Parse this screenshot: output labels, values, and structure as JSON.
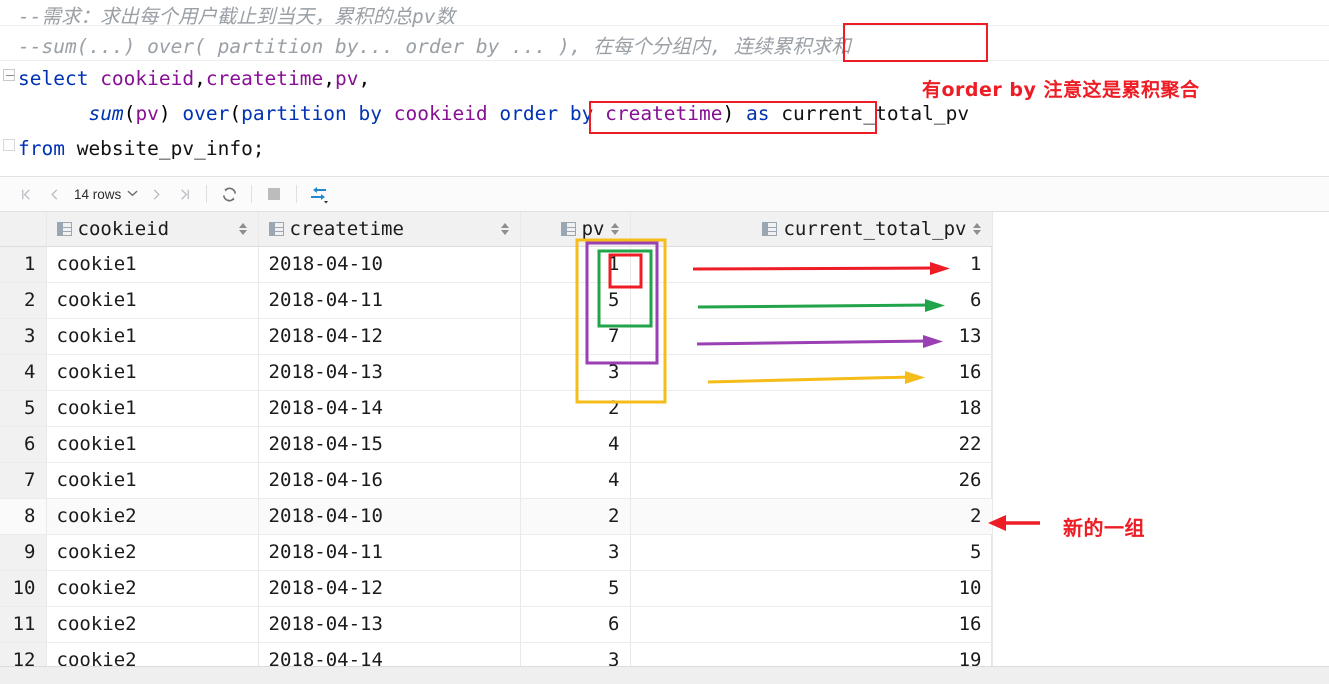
{
  "editor": {
    "lines": [
      {
        "id": "comment-requirement",
        "tokens": [
          {
            "cls": "cmt",
            "text": "--需求：求出每个用户截止到当天，累积的总pv数"
          }
        ]
      },
      {
        "id": "comment-syntax",
        "tokens": [
          {
            "cls": "cmt",
            "text": "--sum(...) over( partition by... order by ... ), 在每个分组内, 连续累积求和"
          }
        ]
      },
      {
        "id": "select-clause",
        "tokens": [
          {
            "cls": "kw",
            "text": "select "
          },
          {
            "cls": "col",
            "text": "cookieid"
          },
          {
            "cls": "sep",
            "text": ","
          },
          {
            "cls": "col",
            "text": "createtime"
          },
          {
            "cls": "sep",
            "text": ","
          },
          {
            "cls": "col",
            "text": "pv"
          },
          {
            "cls": "sep",
            "text": ","
          }
        ]
      },
      {
        "id": "sum-over-clause",
        "tokens": [
          {
            "cls": "pln",
            "text": "      "
          },
          {
            "cls": "fn",
            "text": "sum"
          },
          {
            "cls": "sep",
            "text": "("
          },
          {
            "cls": "col",
            "text": "pv"
          },
          {
            "cls": "sep",
            "text": ") "
          },
          {
            "cls": "kw",
            "text": "over"
          },
          {
            "cls": "sep",
            "text": "("
          },
          {
            "cls": "kw",
            "text": "partition by "
          },
          {
            "cls": "col",
            "text": "cookieid "
          },
          {
            "cls": "kw",
            "text": "order by "
          },
          {
            "cls": "col",
            "text": "createtime"
          },
          {
            "cls": "sep",
            "text": ") "
          },
          {
            "cls": "kw",
            "text": "as "
          },
          {
            "cls": "pln",
            "text": "current_total_pv"
          }
        ]
      },
      {
        "id": "from-clause",
        "tokens": [
          {
            "cls": "kw",
            "text": "from "
          },
          {
            "cls": "pln",
            "text": "website_pv_info;"
          }
        ]
      }
    ],
    "annotations": {
      "boxed_comment_phrase": "连续累积求和",
      "order_by_note": "有order by 注意这是累积聚合",
      "boxed_sql_phrase": "order by createtime)"
    }
  },
  "toolbar": {
    "first_page_icon": "first-page-icon",
    "prev_page_icon": "previous-page-icon",
    "rows_label": "14 rows",
    "rows_caret": "▼",
    "next_page_icon": "next-page-icon",
    "last_page_icon": "last-page-icon",
    "refresh_icon": "refresh-icon",
    "stop_icon": "stop-icon",
    "transpose_icon": "transpose-icon",
    "transpose_caret": "▾"
  },
  "grid": {
    "columns": [
      {
        "key": "rownum",
        "label": "",
        "align": "right"
      },
      {
        "key": "cookieid",
        "label": "cookieid",
        "align": "left"
      },
      {
        "key": "createtime",
        "label": "createtime",
        "align": "left"
      },
      {
        "key": "pv",
        "label": "pv",
        "align": "right"
      },
      {
        "key": "current_total_pv",
        "label": "current_total_pv",
        "align": "right"
      }
    ],
    "rows": [
      {
        "rownum": "1",
        "cookieid": "cookie1",
        "createtime": "2018-04-10",
        "pv": "1",
        "current_total_pv": "1"
      },
      {
        "rownum": "2",
        "cookieid": "cookie1",
        "createtime": "2018-04-11",
        "pv": "5",
        "current_total_pv": "6"
      },
      {
        "rownum": "3",
        "cookieid": "cookie1",
        "createtime": "2018-04-12",
        "pv": "7",
        "current_total_pv": "13"
      },
      {
        "rownum": "4",
        "cookieid": "cookie1",
        "createtime": "2018-04-13",
        "pv": "3",
        "current_total_pv": "16"
      },
      {
        "rownum": "5",
        "cookieid": "cookie1",
        "createtime": "2018-04-14",
        "pv": "2",
        "current_total_pv": "18"
      },
      {
        "rownum": "6",
        "cookieid": "cookie1",
        "createtime": "2018-04-15",
        "pv": "4",
        "current_total_pv": "22"
      },
      {
        "rownum": "7",
        "cookieid": "cookie1",
        "createtime": "2018-04-16",
        "pv": "4",
        "current_total_pv": "26"
      },
      {
        "rownum": "8",
        "cookieid": "cookie2",
        "createtime": "2018-04-10",
        "pv": "2",
        "current_total_pv": "2"
      },
      {
        "rownum": "9",
        "cookieid": "cookie2",
        "createtime": "2018-04-11",
        "pv": "3",
        "current_total_pv": "5"
      },
      {
        "rownum": "10",
        "cookieid": "cookie2",
        "createtime": "2018-04-12",
        "pv": "5",
        "current_total_pv": "10"
      },
      {
        "rownum": "11",
        "cookieid": "cookie2",
        "createtime": "2018-04-13",
        "pv": "6",
        "current_total_pv": "16"
      },
      {
        "rownum": "12",
        "cookieid": "cookie2",
        "createtime": "2018-04-14",
        "pv": "3",
        "current_total_pv": "19"
      }
    ]
  },
  "annotations": {
    "new_group_label": "新的一组",
    "colors": {
      "red": "#ee1c25",
      "green": "#22a44a",
      "purple": "#9b3fb5",
      "yellow": "#f5bd19",
      "comment_gray": "#9aa0a6",
      "keyword_blue": "#0033b3",
      "identifier_purple": "#871094"
    },
    "pv_boxes": [
      {
        "color": "red",
        "covers_rows": [
          1,
          1
        ]
      },
      {
        "color": "green",
        "covers_rows": [
          1,
          2
        ]
      },
      {
        "color": "purple",
        "covers_rows": [
          1,
          3
        ]
      },
      {
        "color": "yellow",
        "covers_rows": [
          1,
          4
        ]
      }
    ],
    "sum_arrows": [
      {
        "color": "red",
        "row": 1,
        "points_to": "1"
      },
      {
        "color": "green",
        "row": 2,
        "points_to": "6"
      },
      {
        "color": "purple",
        "row": 3,
        "points_to": "13"
      },
      {
        "color": "yellow",
        "row": 4,
        "points_to": "16"
      }
    ]
  }
}
